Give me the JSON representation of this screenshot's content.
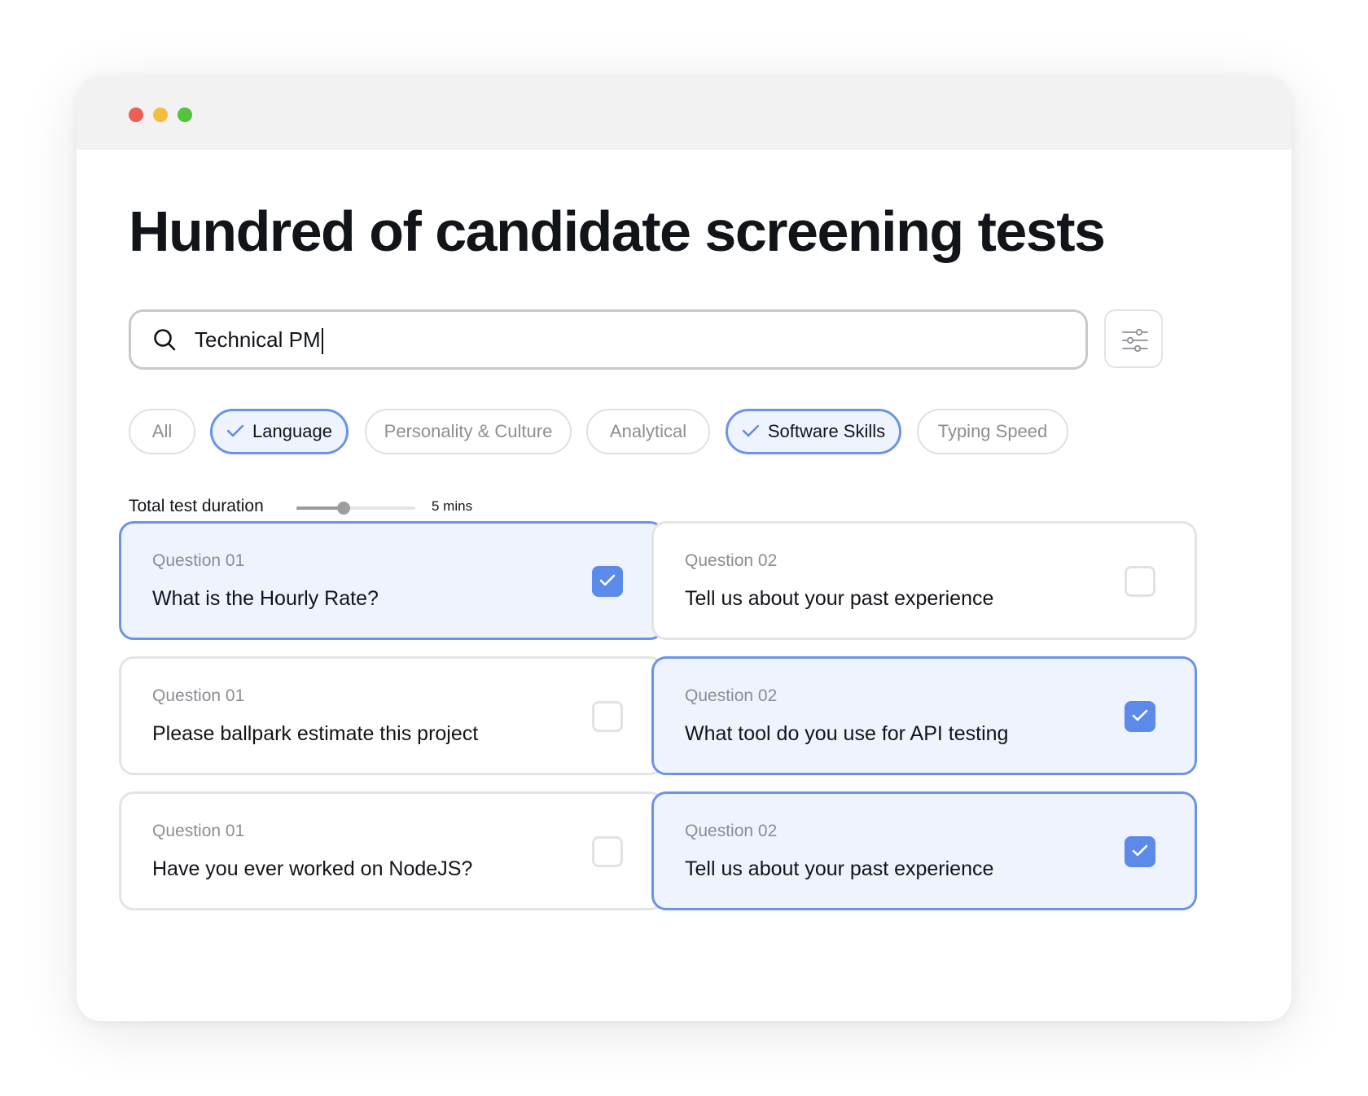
{
  "page": {
    "title": "Hundred of candidate screening tests"
  },
  "search": {
    "value": "Technical PM",
    "icon": "search-icon"
  },
  "filter_button": {
    "icon": "sliders-icon"
  },
  "filters": [
    {
      "label": "All",
      "active": false
    },
    {
      "label": "Language",
      "active": true
    },
    {
      "label": "Personality & Culture",
      "active": false
    },
    {
      "label": "Analytical",
      "active": false
    },
    {
      "label": "Software Skills",
      "active": true
    },
    {
      "label": "Typing Speed",
      "active": false
    }
  ],
  "duration": {
    "label": "Total test duration",
    "value_label": "5 mins",
    "slider_fraction": 0.4
  },
  "questions": [
    {
      "number": "Question 01",
      "text": "What is the Hourly Rate?",
      "checked": true
    },
    {
      "number": "Question 02",
      "text": "Tell us about your past experience",
      "checked": false
    },
    {
      "number": "Question 01",
      "text": "Please ballpark estimate this project",
      "checked": false
    },
    {
      "number": "Question 02",
      "text": "What tool do you use for API testing",
      "checked": true
    },
    {
      "number": "Question 01",
      "text": "Have you ever worked on NodeJS?",
      "checked": false
    },
    {
      "number": "Question 02",
      "text": "Tell us about your past experience",
      "checked": true
    }
  ],
  "colors": {
    "accent": "#6a94e8",
    "checkbox_checked": "#5b8ae8",
    "selected_bg": "#eef3fd",
    "traffic_red": "#ec5f56",
    "traffic_yellow": "#f4bd3e",
    "traffic_green": "#57c23e"
  }
}
